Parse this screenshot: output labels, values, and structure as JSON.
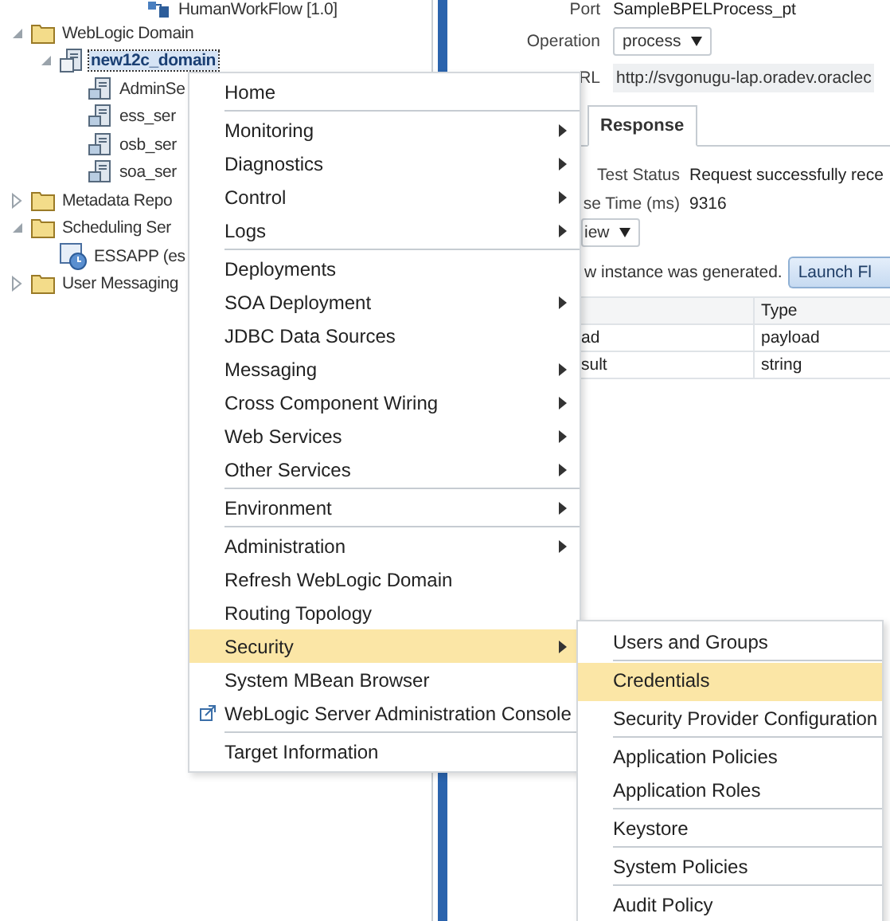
{
  "tree": {
    "scrolled_item": {
      "label": "HumanWorkFlow [1.0]"
    },
    "items": [
      {
        "label": "WebLogic Domain",
        "kind": "folder",
        "expanded": true,
        "selected": false,
        "children": [
          {
            "label": "new12c_domain",
            "kind": "domain",
            "expanded": true,
            "selected": true,
            "children": [
              {
                "label": "AdminSe",
                "kind": "server",
                "selected": false
              },
              {
                "label": "ess_ser",
                "kind": "server",
                "selected": false
              },
              {
                "label": "osb_ser",
                "kind": "server",
                "selected": false
              },
              {
                "label": "soa_ser",
                "kind": "server",
                "selected": false
              }
            ]
          }
        ]
      },
      {
        "label": "Metadata Repo",
        "kind": "folder",
        "expanded": false,
        "selected": false
      },
      {
        "label": "Scheduling Ser",
        "kind": "folder",
        "expanded": true,
        "selected": false,
        "children": [
          {
            "label": "ESSAPP (es",
            "kind": "app",
            "selected": false
          }
        ]
      },
      {
        "label": "User Messaging",
        "kind": "folder",
        "expanded": false,
        "selected": false
      }
    ]
  },
  "test_form": {
    "port_label": "Port",
    "port": "SampleBPELProcess_pt",
    "operation_label": "Operation",
    "operation": "process",
    "url_label": "RL",
    "url": "http://svgonugu-lap.oradev.oraclec",
    "tabs": [
      {
        "label": "Response",
        "selected": true
      }
    ],
    "test_status_label": "Test Status",
    "test_status": "Request successfully rece",
    "time_label": "se Time (ms)",
    "time": "9316",
    "view_dropdown": "iew",
    "message": "w instance was generated.",
    "launch_button": "Launch Fl",
    "table": {
      "columns": [
        "Type"
      ],
      "rows": [
        {
          "column_1": "ad",
          "type": "payload"
        },
        {
          "column_1": "sult",
          "type": "string"
        }
      ]
    }
  },
  "context_menu": {
    "items": [
      {
        "label": "Home",
        "kind": "plain",
        "submenu": false,
        "selected": false,
        "separator_after": true
      },
      {
        "label": "Monitoring",
        "kind": "plain",
        "submenu": true,
        "selected": false,
        "separator_after": false
      },
      {
        "label": "Diagnostics",
        "kind": "plain",
        "submenu": true,
        "selected": false,
        "separator_after": false
      },
      {
        "label": "Control",
        "kind": "plain",
        "submenu": true,
        "selected": false,
        "separator_after": false
      },
      {
        "label": "Logs",
        "kind": "plain",
        "submenu": true,
        "selected": false,
        "separator_after": true
      },
      {
        "label": "Deployments",
        "kind": "plain",
        "submenu": false,
        "selected": false,
        "separator_after": false
      },
      {
        "label": "SOA Deployment",
        "kind": "plain",
        "submenu": true,
        "selected": false,
        "separator_after": false
      },
      {
        "label": "JDBC Data Sources",
        "kind": "plain",
        "submenu": false,
        "selected": false,
        "separator_after": false
      },
      {
        "label": "Messaging",
        "kind": "plain",
        "submenu": true,
        "selected": false,
        "separator_after": false
      },
      {
        "label": "Cross Component Wiring",
        "kind": "plain",
        "submenu": true,
        "selected": false,
        "separator_after": false
      },
      {
        "label": "Web Services",
        "kind": "plain",
        "submenu": true,
        "selected": false,
        "separator_after": false
      },
      {
        "label": "Other Services",
        "kind": "plain",
        "submenu": true,
        "selected": false,
        "separator_after": true
      },
      {
        "label": "Environment",
        "kind": "plain",
        "submenu": true,
        "selected": false,
        "separator_after": true
      },
      {
        "label": "Administration",
        "kind": "plain",
        "submenu": true,
        "selected": false,
        "separator_after": false
      },
      {
        "label": "Refresh WebLogic Domain",
        "kind": "plain",
        "submenu": false,
        "selected": false,
        "separator_after": false
      },
      {
        "label": "Routing Topology",
        "kind": "plain",
        "submenu": false,
        "selected": false,
        "separator_after": false
      },
      {
        "label": "Security",
        "kind": "plain",
        "submenu": true,
        "selected": true,
        "separator_after": false
      },
      {
        "label": "System MBean Browser",
        "kind": "plain",
        "submenu": false,
        "selected": false,
        "separator_after": false
      },
      {
        "label": "WebLogic Server Administration Console",
        "kind": "external",
        "submenu": false,
        "selected": false,
        "separator_after": true
      },
      {
        "label": "Target Information",
        "kind": "plain",
        "submenu": false,
        "selected": false,
        "separator_after": false
      }
    ]
  },
  "security_submenu": {
    "items": [
      {
        "label": "Users and Groups",
        "selected": false,
        "separator_after": true
      },
      {
        "label": "Credentials",
        "selected": true,
        "separator_after": true
      },
      {
        "label": "Security Provider Configuration",
        "selected": false,
        "separator_after": true
      },
      {
        "label": "Application Policies",
        "selected": false,
        "separator_after": false
      },
      {
        "label": "Application Roles",
        "selected": false,
        "separator_after": true
      },
      {
        "label": "Keystore",
        "selected": false,
        "separator_after": true
      },
      {
        "label": "System Policies",
        "selected": false,
        "separator_after": true
      },
      {
        "label": "Audit Policy",
        "selected": false,
        "separator_after": false
      }
    ]
  }
}
